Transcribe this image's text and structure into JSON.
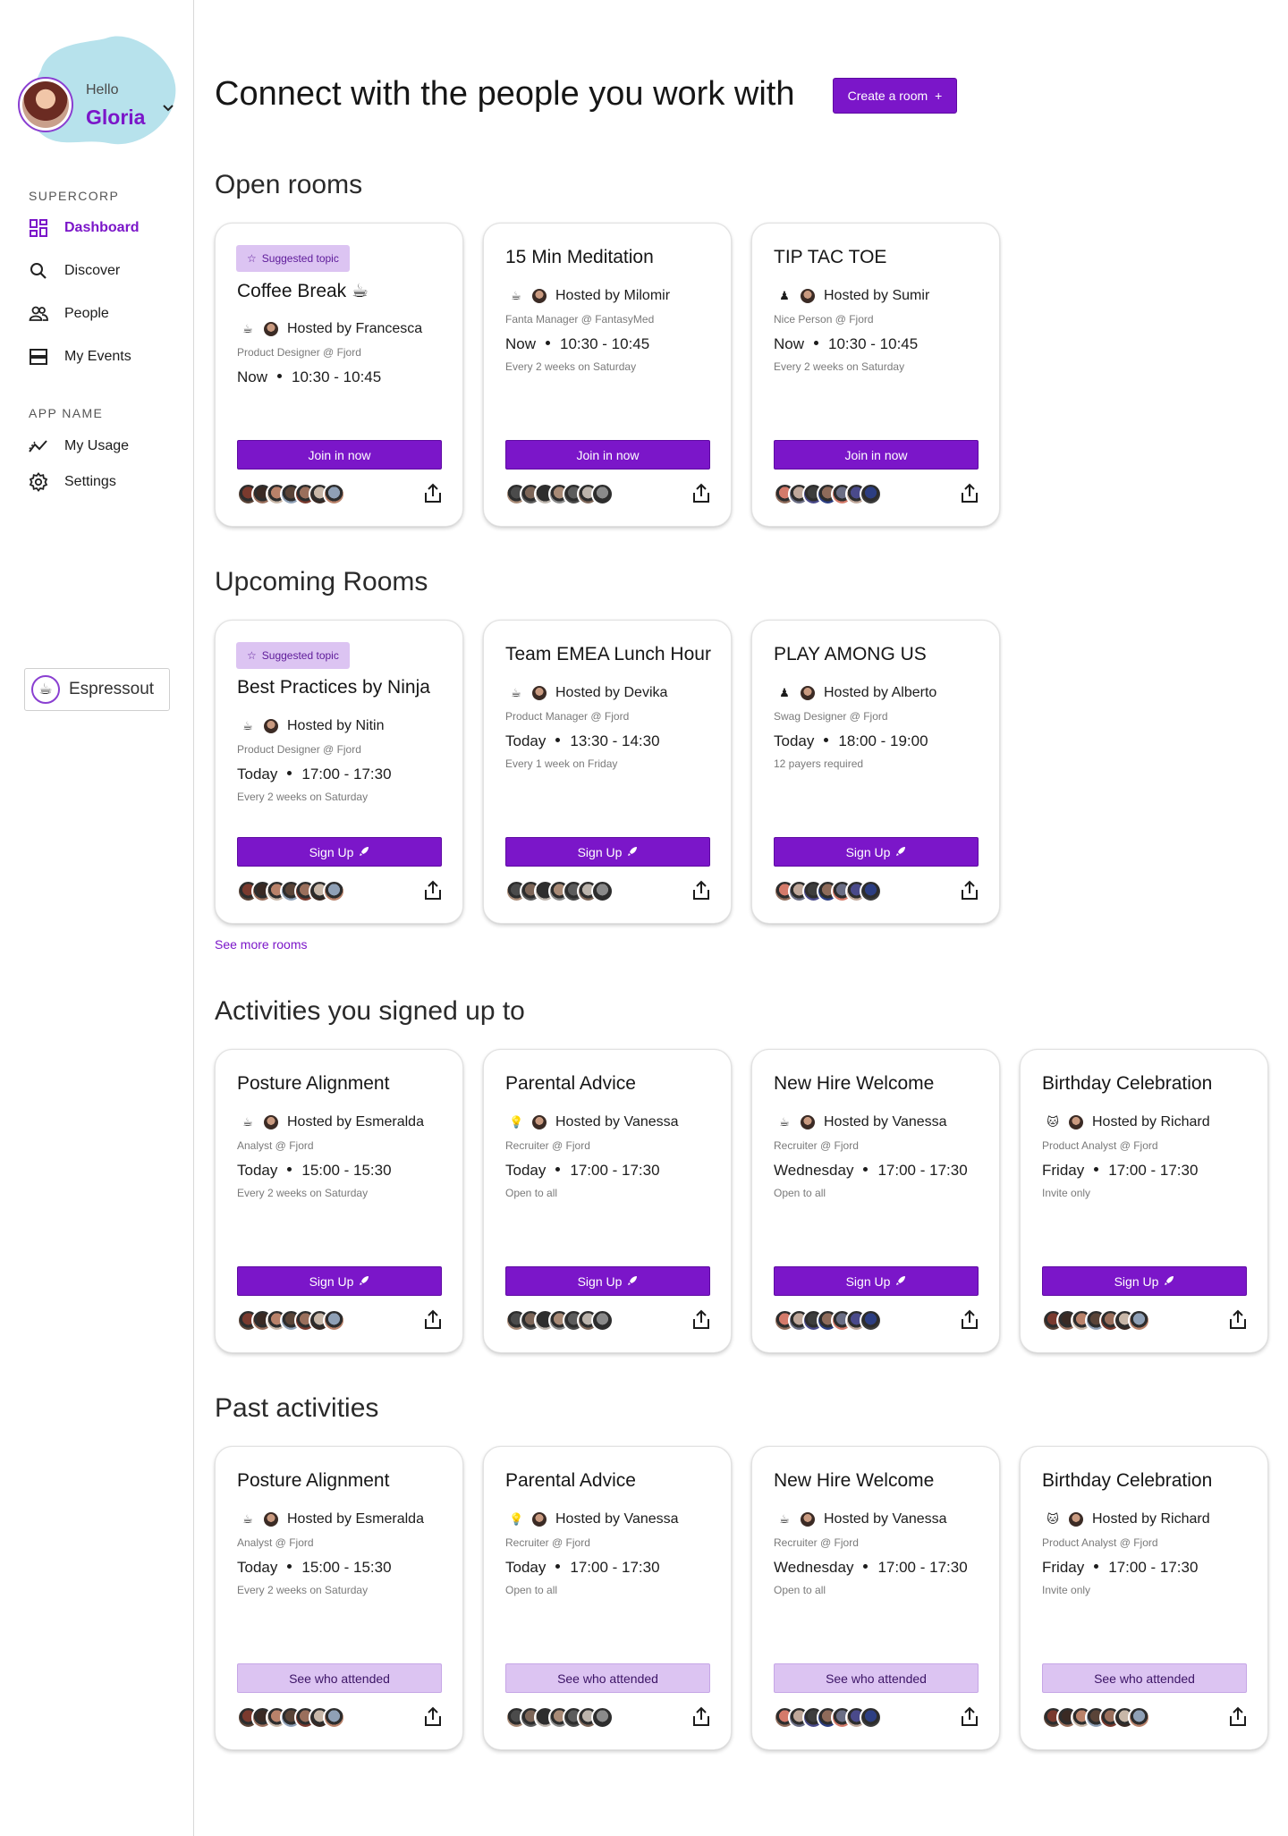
{
  "user": {
    "greeting": "Hello",
    "name": "Gloria"
  },
  "sidebar": {
    "org_label": "SUPERCORP",
    "nav": [
      {
        "label": "Dashboard",
        "icon": "dashboard-icon"
      },
      {
        "label": "Discover",
        "icon": "search-icon"
      },
      {
        "label": "People",
        "icon": "people-icon"
      },
      {
        "label": "My Events",
        "icon": "events-icon"
      }
    ],
    "app_label": "APP NAME",
    "app_nav": [
      {
        "label": "My Usage",
        "icon": "usage-icon"
      },
      {
        "label": "Settings",
        "icon": "gear-icon"
      }
    ],
    "brand": "Espressout"
  },
  "header": {
    "title": "Connect with the people you work with",
    "create_label": "Create a room",
    "create_icon": "+"
  },
  "colors": {
    "accent": "#7b16c9",
    "accent_light": "#dcc4f2"
  },
  "sections": {
    "open": {
      "title": "Open rooms",
      "cards": [
        {
          "badge": "Suggested topic",
          "title": "Coffee Break ☕",
          "topic_emoji": "☕",
          "host": "Hosted by Francesca",
          "role": "Product Designer @ Fjord",
          "when": "Now",
          "time": "10:30 - 10:45",
          "recur": "",
          "action": "Join in now"
        },
        {
          "badge": "",
          "title": "15 Min Meditation",
          "topic_emoji": "☕",
          "host": "Hosted by Milomir",
          "role": "Fanta Manager @ FantasyMed",
          "when": "Now",
          "time": "10:30 - 10:45",
          "recur": "Every 2 weeks on Saturday",
          "action": "Join in now"
        },
        {
          "badge": "",
          "title": "TIP TAC TOE",
          "topic_emoji": "♟",
          "host": "Hosted by Sumir",
          "role": "Nice Person @ Fjord",
          "when": "Now",
          "time": "10:30 - 10:45",
          "recur": "Every 2 weeks on Saturday",
          "action": "Join in now"
        }
      ]
    },
    "upcoming": {
      "title": "Upcoming Rooms",
      "see_more": "See more rooms",
      "cards": [
        {
          "badge": "Suggested topic",
          "title": "Best Practices by Ninja",
          "topic_emoji": "☕",
          "host": "Hosted by Nitin",
          "role": "Product Designer @ Fjord",
          "when": "Today",
          "time": "17:00 - 17:30",
          "recur": "Every 2 weeks on Saturday",
          "action": "Sign Up"
        },
        {
          "badge": "",
          "title": "Team EMEA Lunch Hour",
          "topic_emoji": "☕",
          "host": "Hosted by Devika",
          "role": "Product Manager @ Fjord",
          "when": "Today",
          "time": "13:30 - 14:30",
          "recur": "Every 1 week on Friday",
          "action": "Sign Up"
        },
        {
          "badge": "",
          "title": "PLAY AMONG US",
          "topic_emoji": "♟",
          "host": "Hosted by Alberto",
          "role": "Swag Designer @ Fjord",
          "when": "Today",
          "time": "18:00 - 19:00",
          "recur": "12 payers required",
          "action": "Sign Up"
        }
      ]
    },
    "signed": {
      "title": "Activities you signed up to",
      "cards": [
        {
          "badge": "",
          "title": "Posture Alignment",
          "topic_emoji": "☕",
          "host": "Hosted by Esmeralda",
          "role": "Analyst @ Fjord",
          "when": "Today",
          "time": "15:00 - 15:30",
          "recur": "Every 2 weeks on Saturday",
          "action": "Sign Up"
        },
        {
          "badge": "",
          "title": "Parental Advice",
          "topic_emoji": "💡",
          "host": "Hosted by Vanessa",
          "role": "Recruiter @ Fjord",
          "when": "Today",
          "time": "17:00 - 17:30",
          "recur": "Open to all",
          "action": "Sign Up"
        },
        {
          "badge": "",
          "title": "New Hire Welcome",
          "topic_emoji": "☕",
          "host": "Hosted by Vanessa",
          "role": "Recruiter @ Fjord",
          "when": "Wednesday",
          "time": "17:00 - 17:30",
          "recur": "Open to all",
          "action": "Sign Up"
        },
        {
          "badge": "",
          "title": "Birthday Celebration",
          "topic_emoji": "🐱",
          "host": "Hosted by Richard",
          "role": "Product Analyst @ Fjord",
          "when": "Friday",
          "time": "17:00 - 17:30",
          "recur": "Invite only",
          "action": "Sign Up"
        }
      ]
    },
    "past": {
      "title": "Past activities",
      "cards": [
        {
          "badge": "",
          "title": "Posture Alignment",
          "topic_emoji": "☕",
          "host": "Hosted by Esmeralda",
          "role": "Analyst @ Fjord",
          "when": "Today",
          "time": "15:00 - 15:30",
          "recur": "Every 2 weeks on Saturday",
          "action": "See who attended"
        },
        {
          "badge": "",
          "title": "Parental Advice",
          "topic_emoji": "💡",
          "host": "Hosted by Vanessa",
          "role": "Recruiter @ Fjord",
          "when": "Today",
          "time": "17:00 - 17:30",
          "recur": "Open to all",
          "action": "See who attended"
        },
        {
          "badge": "",
          "title": "New Hire Welcome",
          "topic_emoji": "☕",
          "host": "Hosted by Vanessa",
          "role": "Recruiter @ Fjord",
          "when": "Wednesday",
          "time": "17:00 - 17:30",
          "recur": "Open to all",
          "action": "See who attended"
        },
        {
          "badge": "",
          "title": "Birthday Celebration",
          "topic_emoji": "🐱",
          "host": "Hosted by Richard",
          "role": "Product Analyst @ Fjord",
          "when": "Friday",
          "time": "17:00 - 17:30",
          "recur": "Invite only",
          "action": "See who attended"
        }
      ]
    }
  }
}
